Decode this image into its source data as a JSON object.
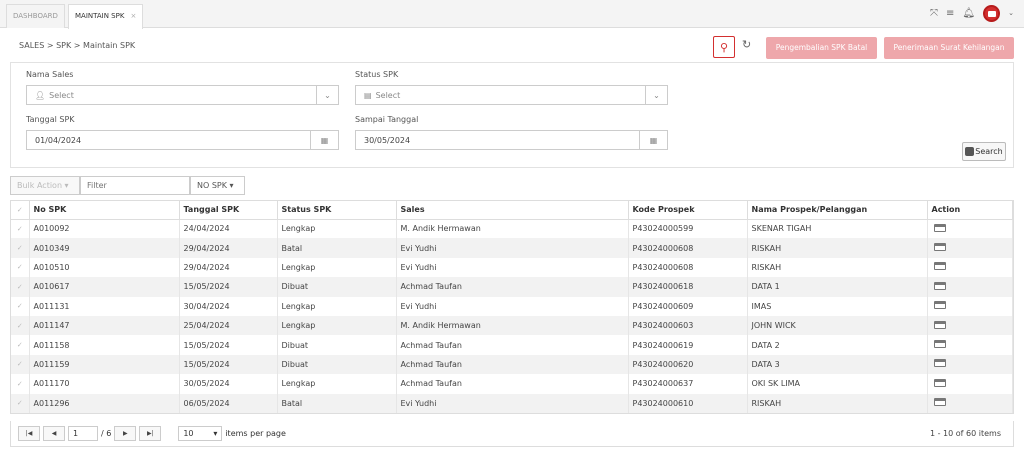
{
  "tabs": [
    {
      "label": "DASHBOARD"
    },
    {
      "label": "MAINTAIN SPK",
      "close": "×"
    }
  ],
  "breadcrumb": {
    "l1": "SALES",
    "l2": "SPK",
    "l3": "Maintain SPK",
    "sep": ">"
  },
  "actions": {
    "btn1": "Pengembalian SPK Batal",
    "btn2": "Penerimaan Surat Kehilangan"
  },
  "filters": {
    "nama_sales": {
      "label": "Nama Sales",
      "placeholder": "Select"
    },
    "status_spk": {
      "label": "Status SPK",
      "placeholder": "Select"
    },
    "tanggal_spk": {
      "label": "Tanggal SPK",
      "value": "01/04/2024"
    },
    "sampai_tanggal": {
      "label": "Sampai Tanggal",
      "value": "30/05/2024"
    },
    "search_label": "Search"
  },
  "toolbar": {
    "bulk": "Bulk Action",
    "filter_placeholder": "Filter",
    "nospk": "NO SPK"
  },
  "columns": [
    "No SPK",
    "Tanggal SPK",
    "Status SPK",
    "Sales",
    "Kode Prospek",
    "Nama Prospek/Pelanggan",
    "Action"
  ],
  "rows": [
    [
      "A010092",
      "24/04/2024",
      "Lengkap",
      "M. Andik Hermawan",
      "P43024000599",
      "SKENAR TIGAH"
    ],
    [
      "A010349",
      "29/04/2024",
      "Batal",
      "Evi Yudhi",
      "P43024000608",
      "RISKAH"
    ],
    [
      "A010510",
      "29/04/2024",
      "Lengkap",
      "Evi Yudhi",
      "P43024000608",
      "RISKAH"
    ],
    [
      "A010617",
      "15/05/2024",
      "Dibuat",
      "Achmad Taufan",
      "P43024000618",
      "DATA 1"
    ],
    [
      "A011131",
      "30/04/2024",
      "Lengkap",
      "Evi Yudhi",
      "P43024000609",
      "IMAS"
    ],
    [
      "A011147",
      "25/04/2024",
      "Lengkap",
      "M. Andik Hermawan",
      "P43024000603",
      "JOHN WICK"
    ],
    [
      "A011158",
      "15/05/2024",
      "Dibuat",
      "Achmad Taufan",
      "P43024000619",
      "DATA 2"
    ],
    [
      "A011159",
      "15/05/2024",
      "Dibuat",
      "Achmad Taufan",
      "P43024000620",
      "DATA 3"
    ],
    [
      "A011170",
      "30/05/2024",
      "Lengkap",
      "Achmad Taufan",
      "P43024000637",
      "OKI SK LIMA"
    ],
    [
      "A011296",
      "06/05/2024",
      "Batal",
      "Evi Yudhi",
      "P43024000610",
      "RISKAH"
    ]
  ],
  "pager": {
    "page": "1",
    "of": "/ 6",
    "size": "10",
    "per_page": "items per page",
    "info": "1 - 10 of 60 items"
  },
  "colors": {
    "accent": "#d32f2f",
    "pink_button": "#eea7ab"
  },
  "icons": [
    "expand-icon",
    "menu-icon",
    "bell-icon",
    "user-avatar",
    "search-icon",
    "refresh-icon",
    "user-icon",
    "calendar-icon",
    "database-icon",
    "action-icon"
  ]
}
